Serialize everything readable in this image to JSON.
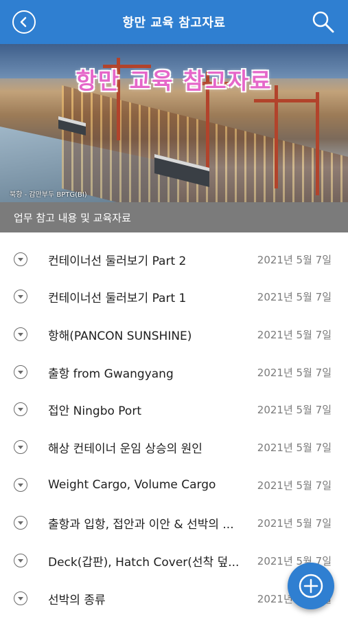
{
  "appbar": {
    "title": "항만 교육 참고자료",
    "back_icon": "back-arrow-circle-icon",
    "search_icon": "search-icon"
  },
  "hero": {
    "title": "항만 교육 참고자료",
    "caption": "북항 - 감만부두 BPTG(BI)"
  },
  "section": {
    "title": "업무 참고 내용 및 교육자료"
  },
  "items": [
    {
      "label": "컨테이너선 둘러보기 Part 2",
      "date": "2021년 5월 7일"
    },
    {
      "label": "컨테이너선 둘러보기 Part 1",
      "date": "2021년 5월 7일"
    },
    {
      "label": "항해(PANCON SUNSHINE)",
      "date": "2021년 5월 7일"
    },
    {
      "label": "출항 from Gwangyang",
      "date": "2021년 5월 7일"
    },
    {
      "label": "접안 Ningbo Port",
      "date": "2021년 5월 7일"
    },
    {
      "label": "해상 컨테이너 운임 상승의 원인",
      "date": "2021년 5월 7일"
    },
    {
      "label": "Weight Cargo, Volume Cargo",
      "date": "2021년 5월 7일"
    },
    {
      "label": "출항과 입항, 접안과 이안 & 선박의 ...",
      "date": "2021년 5월 7일"
    },
    {
      "label": "Deck(갑판), Hatch Cover(선착 덮...",
      "date": "2021년 5월 7일"
    },
    {
      "label": "선박의 종류",
      "date": "2021년 5월 7일"
    }
  ],
  "fab": {
    "icon": "plus-icon"
  },
  "colors": {
    "primary": "#2f7fd1",
    "section_bar": "#7b7b7b",
    "hero_title": "#e567c9"
  }
}
